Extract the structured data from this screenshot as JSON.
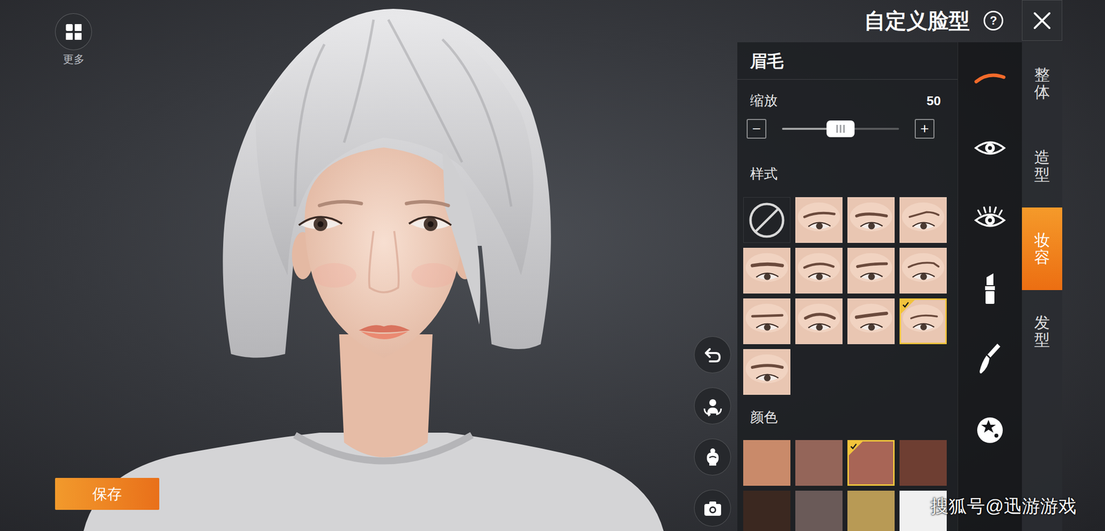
{
  "more_button": {
    "label": "更多"
  },
  "title": "自定义脸型",
  "help_icon": "?",
  "category_tabs": [
    {
      "label": "整体",
      "selected": false
    },
    {
      "label": "造型",
      "selected": false
    },
    {
      "label": "妆容",
      "selected": true
    },
    {
      "label": "发型",
      "selected": false
    }
  ],
  "makeup_icons": [
    {
      "kind": "eyebrow",
      "selected": true
    },
    {
      "kind": "eye",
      "selected": false
    },
    {
      "kind": "eyelash",
      "selected": false
    },
    {
      "kind": "lipstick",
      "selected": false
    },
    {
      "kind": "brush",
      "selected": false
    },
    {
      "kind": "sticker",
      "selected": false
    }
  ],
  "panel": {
    "title": "眉毛",
    "scale": {
      "label": "缩放",
      "value": "50",
      "level": 0.5,
      "minus": "−",
      "plus": "+"
    },
    "styles_label": "样式",
    "styles": [
      {
        "kind": "none",
        "selected": false
      },
      {
        "kind": "style",
        "selected": false
      },
      {
        "kind": "style",
        "selected": false
      },
      {
        "kind": "style",
        "selected": false
      },
      {
        "kind": "style",
        "selected": false
      },
      {
        "kind": "style",
        "selected": false
      },
      {
        "kind": "style",
        "selected": false
      },
      {
        "kind": "style",
        "selected": false
      },
      {
        "kind": "style",
        "selected": false
      },
      {
        "kind": "style",
        "selected": false
      },
      {
        "kind": "style",
        "selected": false
      },
      {
        "kind": "style",
        "selected": true
      },
      {
        "kind": "style",
        "selected": false
      }
    ],
    "color_label": "颜色",
    "colors": [
      {
        "color": "#c98a6a",
        "selected": false
      },
      {
        "color": "#946559",
        "selected": false
      },
      {
        "color": "#a86556",
        "selected": true
      },
      {
        "color": "#6e3e32",
        "selected": false
      },
      {
        "color": "#3b2820",
        "selected": false
      },
      {
        "color": "#6a5a58",
        "selected": false
      },
      {
        "color": "#b89a55",
        "selected": false
      },
      {
        "color": "#f0f0f0",
        "selected": false
      }
    ]
  },
  "side_buttons": [
    {
      "kind": "undo"
    },
    {
      "kind": "rotate"
    },
    {
      "kind": "hair"
    },
    {
      "kind": "camera"
    }
  ],
  "save_button": "保存",
  "watermark": "搜狐号@迅游游戏"
}
